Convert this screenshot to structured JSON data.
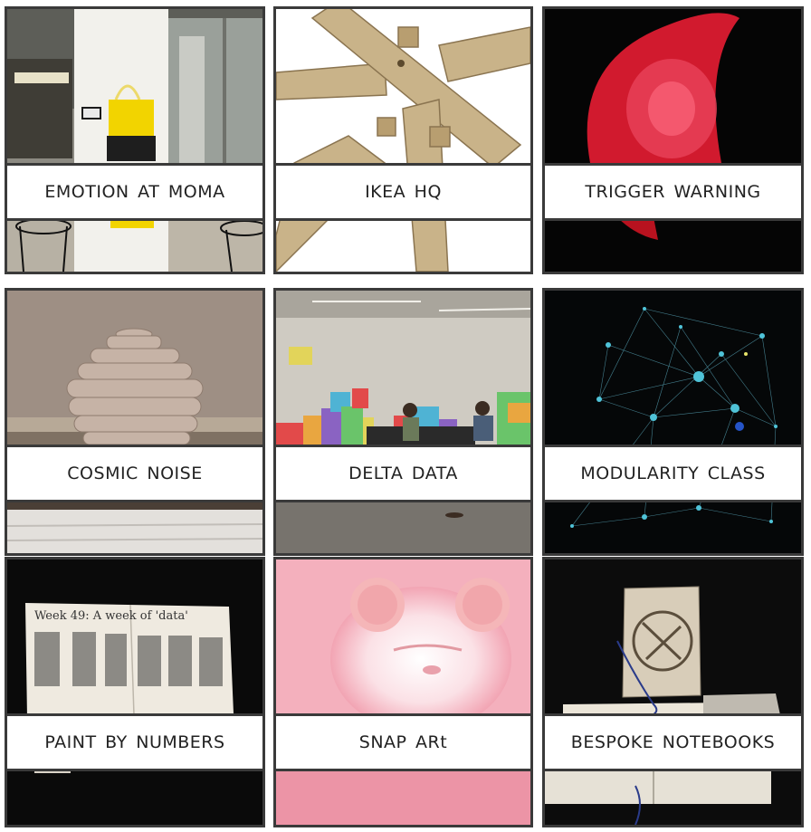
{
  "projects": [
    {
      "label": "EMOTION AT MOMA"
    },
    {
      "label": "IKEA HQ"
    },
    {
      "label": "TRIGGER WARNING"
    },
    {
      "label": "COSMIC NOISE"
    },
    {
      "label": "DELTA DATA"
    },
    {
      "label": "MODULARITY CLASS"
    },
    {
      "label": "PAINT BY NUMBERS"
    },
    {
      "label": "SNAP ARt"
    },
    {
      "label": "BESPOKE NOTEBOOKS"
    }
  ],
  "artwork_text": {
    "week_title": "Week 49: A week of 'data'"
  },
  "colors": {
    "frame": "#3a3a3a",
    "label_background": "#ffffff",
    "label_text": "#222222"
  }
}
